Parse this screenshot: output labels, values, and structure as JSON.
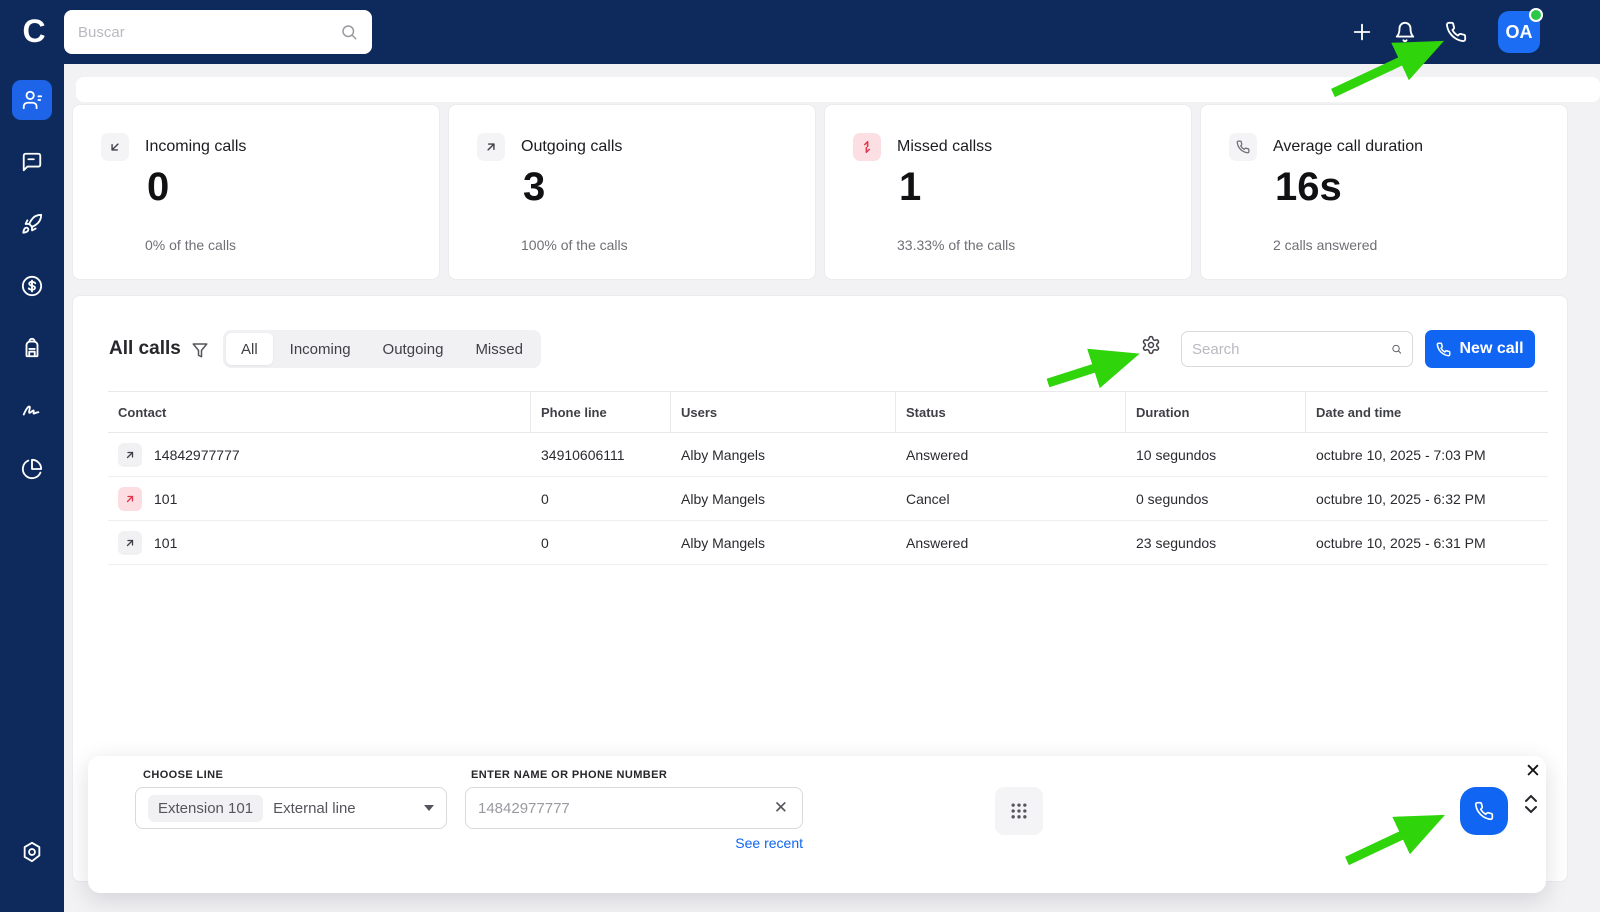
{
  "topbar": {
    "search_placeholder": "Buscar",
    "avatar_initials": "OA"
  },
  "sidebar": {
    "items": [
      "contacts",
      "messages",
      "rocket",
      "billing",
      "backpack",
      "signature",
      "analytics"
    ],
    "bottom_item": "settings"
  },
  "cards": [
    {
      "icon": "incoming-arrow",
      "title": "Incoming calls",
      "value": "0",
      "subtitle": "0% of the calls"
    },
    {
      "icon": "outgoing-arrow",
      "title": "Outgoing calls",
      "value": "3",
      "subtitle": "100% of the calls"
    },
    {
      "icon": "missed-arrows",
      "title": "Missed callss",
      "value": "1",
      "subtitle": "33.33% of the calls"
    },
    {
      "icon": "phone",
      "title": "Average call duration",
      "value": "16s",
      "subtitle": "2 calls answered"
    }
  ],
  "calls_section": {
    "title": "All calls",
    "tabs": [
      "All",
      "Incoming",
      "Outgoing",
      "Missed"
    ],
    "active_tab": "All",
    "search_placeholder": "Search",
    "new_call_label": "New call"
  },
  "table": {
    "columns": [
      "Contact",
      "Phone line",
      "Users",
      "Status",
      "Duration",
      "Date and time"
    ],
    "rows": [
      {
        "direction": "outgoing",
        "contact": "14842977777",
        "phone_line": "34910606111",
        "user": "Alby Mangels",
        "status": "Answered",
        "duration": "10 segundos",
        "datetime": "octubre 10, 2025 - 7:03 PM"
      },
      {
        "direction": "outgoing-cancelled",
        "contact": "101",
        "phone_line": "0",
        "user": "Alby Mangels",
        "status": "Cancel",
        "duration": "0 segundos",
        "datetime": "octubre 10, 2025 - 6:32 PM"
      },
      {
        "direction": "outgoing",
        "contact": "101",
        "phone_line": "0",
        "user": "Alby Mangels",
        "status": "Answered",
        "duration": "23 segundos",
        "datetime": "octubre 10, 2025 - 6:31 PM"
      }
    ]
  },
  "dialer": {
    "choose_line_label": "CHOOSE LINE",
    "line_chip": "Extension 101",
    "line_value": "External line",
    "number_label": "ENTER NAME OR PHONE NUMBER",
    "number_placeholder": "14842977777",
    "see_recent_label": "See recent",
    "close_glyph": "✕"
  },
  "colors": {
    "navy": "#0e2a5c",
    "accent_blue": "#1065f2",
    "annotation_green": "#2fd40b",
    "missed_red": "#e0354b",
    "online_green": "#2bc748"
  }
}
